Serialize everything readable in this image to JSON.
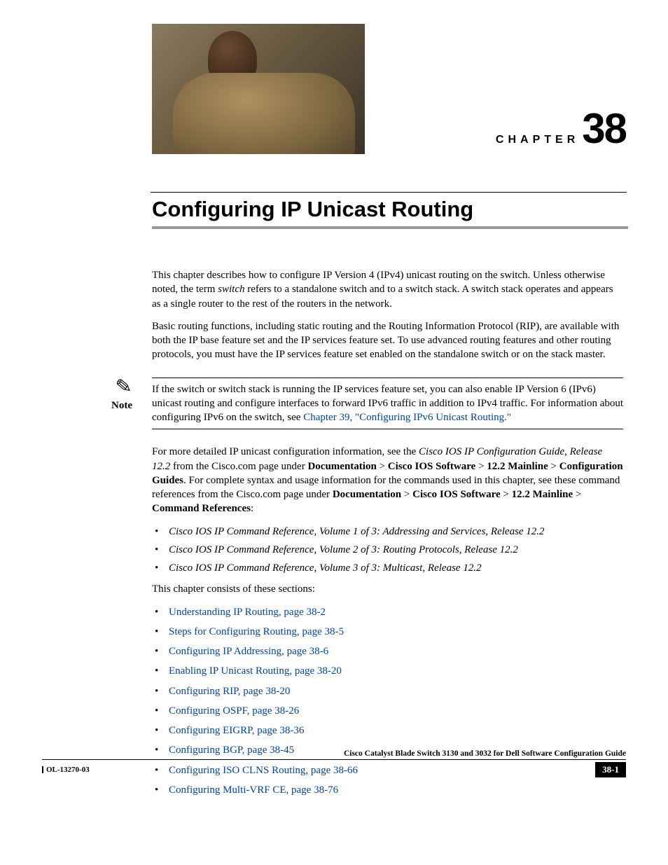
{
  "chapter": {
    "label": "CHAPTER",
    "number": "38"
  },
  "title": "Configuring IP Unicast Routing",
  "para1_a": "This chapter describes how to configure IP Version 4 (IPv4) unicast routing on the switch. Unless otherwise noted, the term ",
  "para1_i": "switch",
  "para1_b": " refers to a standalone switch and to a switch stack. A switch stack operates and appears as a single router to the rest of the routers in the network.",
  "para2": "Basic routing functions, including static routing and the Routing Information Protocol (RIP), are available with both the IP base feature set and the IP services feature set. To use advanced routing features and other routing protocols, you must have the IP services feature set enabled on the standalone switch or on the stack master.",
  "note": {
    "label": "Note",
    "text_a": "If the switch or switch stack is running the IP services feature set, you can also enable IP Version 6 (IPv6) unicast routing and configure interfaces to forward IPv6 traffic in addition to IPv4 traffic. For information about configuring IPv6 on the switch, see ",
    "link": "Chapter 39, \"Configuring IPv6 Unicast Routing.\""
  },
  "para3": {
    "a": "For more detailed IP unicast configuration information, see the ",
    "i1": "Cisco IOS IP Configuration Guide, Release 12.2",
    "b": " from the Cisco.com page under ",
    "b1": "Documentation",
    "gt1": " > ",
    "b2": "Cisco IOS Software",
    "gt2": " > ",
    "b3": "12.2 Mainline",
    "gt3": " > ",
    "b4": "Configuration Guides",
    "c": ". For complete syntax and usage information for the commands used in this chapter, see these command references from the Cisco.com page under ",
    "b5": "Documentation",
    "gt4": " > ",
    "b6": "Cisco IOS Software",
    "gt5": " > ",
    "b7": "12.2 Mainline",
    "gt6": " > ",
    "b8": "Command References",
    "d": ":"
  },
  "refs": [
    "Cisco IOS IP Command Reference, Volume 1 of 3: Addressing and Services, Release 12.2",
    "Cisco IOS IP Command Reference, Volume 2 of 3: Routing Protocols, Release 12.2",
    "Cisco IOS IP Command Reference, Volume 3 of 3: Multicast, Release 12.2"
  ],
  "sections_intro": "This chapter consists of these sections:",
  "sections": [
    "Understanding IP Routing, page 38-2",
    "Steps for Configuring Routing, page 38-5",
    "Configuring IP Addressing, page 38-6",
    "Enabling IP Unicast Routing, page 38-20",
    "Configuring RIP, page 38-20",
    "Configuring OSPF, page 38-26",
    "Configuring EIGRP, page 38-36",
    "Configuring BGP, page 38-45",
    "Configuring ISO CLNS Routing, page 38-66",
    "Configuring Multi-VRF CE, page 38-76"
  ],
  "footer": {
    "guide": "Cisco Catalyst Blade Switch 3130 and 3032 for Dell Software Configuration Guide",
    "doc": "OL-13270-03",
    "pagenum": "38-1"
  }
}
